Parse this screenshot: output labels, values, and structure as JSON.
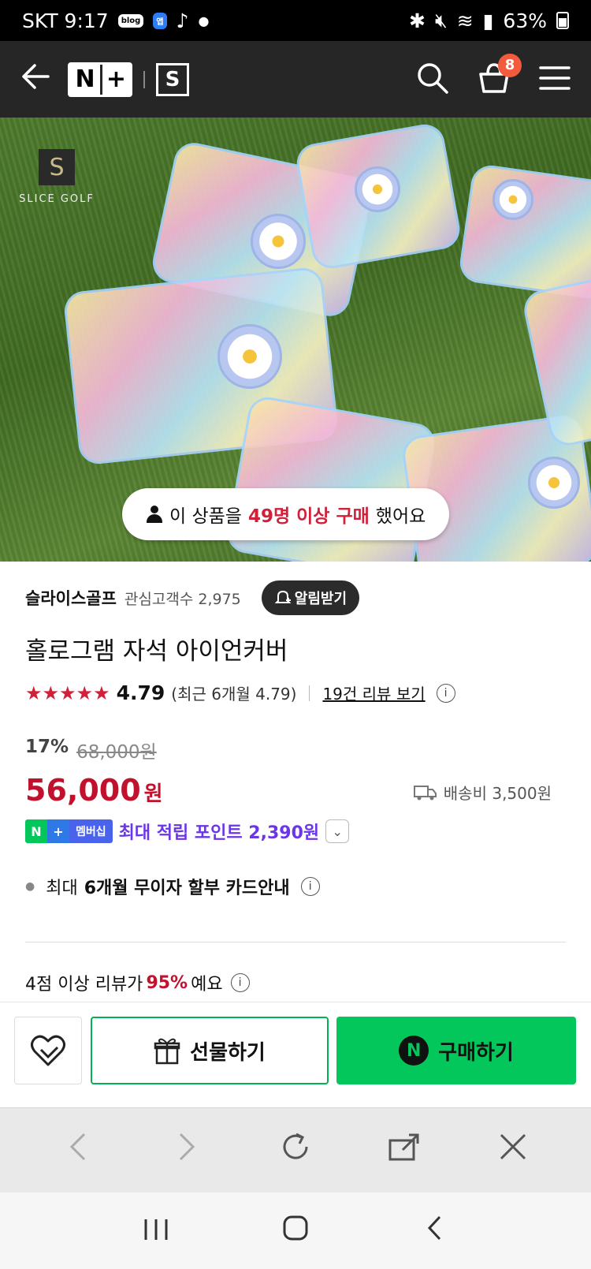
{
  "status_bar": {
    "carrier_time": "SKT 9:17",
    "badge_blog": "blog",
    "badge_app": "앱",
    "battery": "63%"
  },
  "header": {
    "logo_n": "N",
    "logo_plus": "+",
    "store_logo": "S",
    "cart_count": "8"
  },
  "hero": {
    "brand_logo": "S",
    "brand_text": "SLICE GOLF",
    "purchase_prefix": "이 상품을",
    "purchase_highlight": "49명 이상 구매",
    "purchase_suffix": "했어요"
  },
  "store": {
    "name": "슬라이스골프",
    "fans": "관심고객수 2,975",
    "alarm_label": "알림받기"
  },
  "product": {
    "title": "홀로그램 자석 아이언커버",
    "stars": "★★★★★",
    "rating": "4.79",
    "rating_recent": "(최근 6개월 4.79)",
    "review_link": "19건 리뷰 보기",
    "discount": "17%",
    "original_price": "68,000원",
    "price": "56,000",
    "price_unit": "원",
    "shipping": "배송비 3,500원",
    "membership_badge_n": "N",
    "membership_badge_plus": "+",
    "membership_badge_label": "멤버십",
    "membership_text": "최대 적립 포인트 2,390원",
    "installment_prefix": "최대",
    "installment_bold": "6개월 무이자 할부 카드안내",
    "review_stat_prefix": "4점 이상 리뷰가",
    "review_stat_value": "95%",
    "review_stat_suffix": "예요"
  },
  "actions": {
    "gift_label": "선물하기",
    "buy_label": "구매하기",
    "buy_icon": "N"
  },
  "colors": {
    "naver_green": "#03c75a",
    "price_red": "#c2112d",
    "membership_purple": "#6b35e8",
    "header_bg": "#262626"
  }
}
